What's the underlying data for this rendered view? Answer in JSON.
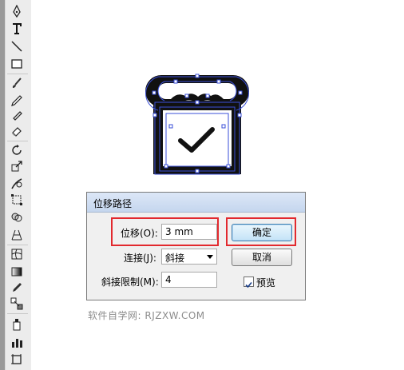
{
  "toolbar": {
    "tools": [
      {
        "icon": "pen-tool-icon"
      },
      {
        "icon": "type-tool-icon"
      },
      {
        "icon": "line-segment-tool-icon"
      },
      {
        "icon": "rectangle-tool-icon"
      },
      {
        "icon": "paintbrush-tool-icon"
      },
      {
        "icon": "pencil-tool-icon"
      },
      {
        "icon": "eraser-tool-icon"
      },
      {
        "icon": "rotate-tool-icon"
      },
      {
        "icon": "scale-tool-icon"
      },
      {
        "icon": "warp-tool-icon"
      },
      {
        "icon": "free-transform-tool-icon"
      },
      {
        "icon": "shape-builder-tool-icon"
      },
      {
        "icon": "perspective-grid-tool-icon"
      },
      {
        "icon": "mesh-tool-icon"
      },
      {
        "icon": "gradient-tool-icon"
      },
      {
        "icon": "eyedropper-tool-icon"
      },
      {
        "icon": "blend-tool-icon"
      },
      {
        "icon": "symbol-sprayer-tool-icon"
      },
      {
        "icon": "column-graph-tool-icon"
      },
      {
        "icon": "artboard-tool-icon"
      }
    ]
  },
  "dialog": {
    "title": "位移路径",
    "offset_label": "位移(O):",
    "offset_value": "3 mm",
    "joins_label": "连接(J):",
    "joins_value": "斜接",
    "miter_limit_label": "斜接限制(M):",
    "miter_limit_value": "4",
    "ok_label": "确定",
    "cancel_label": "取消",
    "preview_label": "预览",
    "preview_checked": true
  },
  "colors": {
    "highlight": "#e2292e",
    "path_selection": "#3a4fd8",
    "artwork_fill": "#111111"
  },
  "watermark": "软件自学网: RJZXW.COM"
}
